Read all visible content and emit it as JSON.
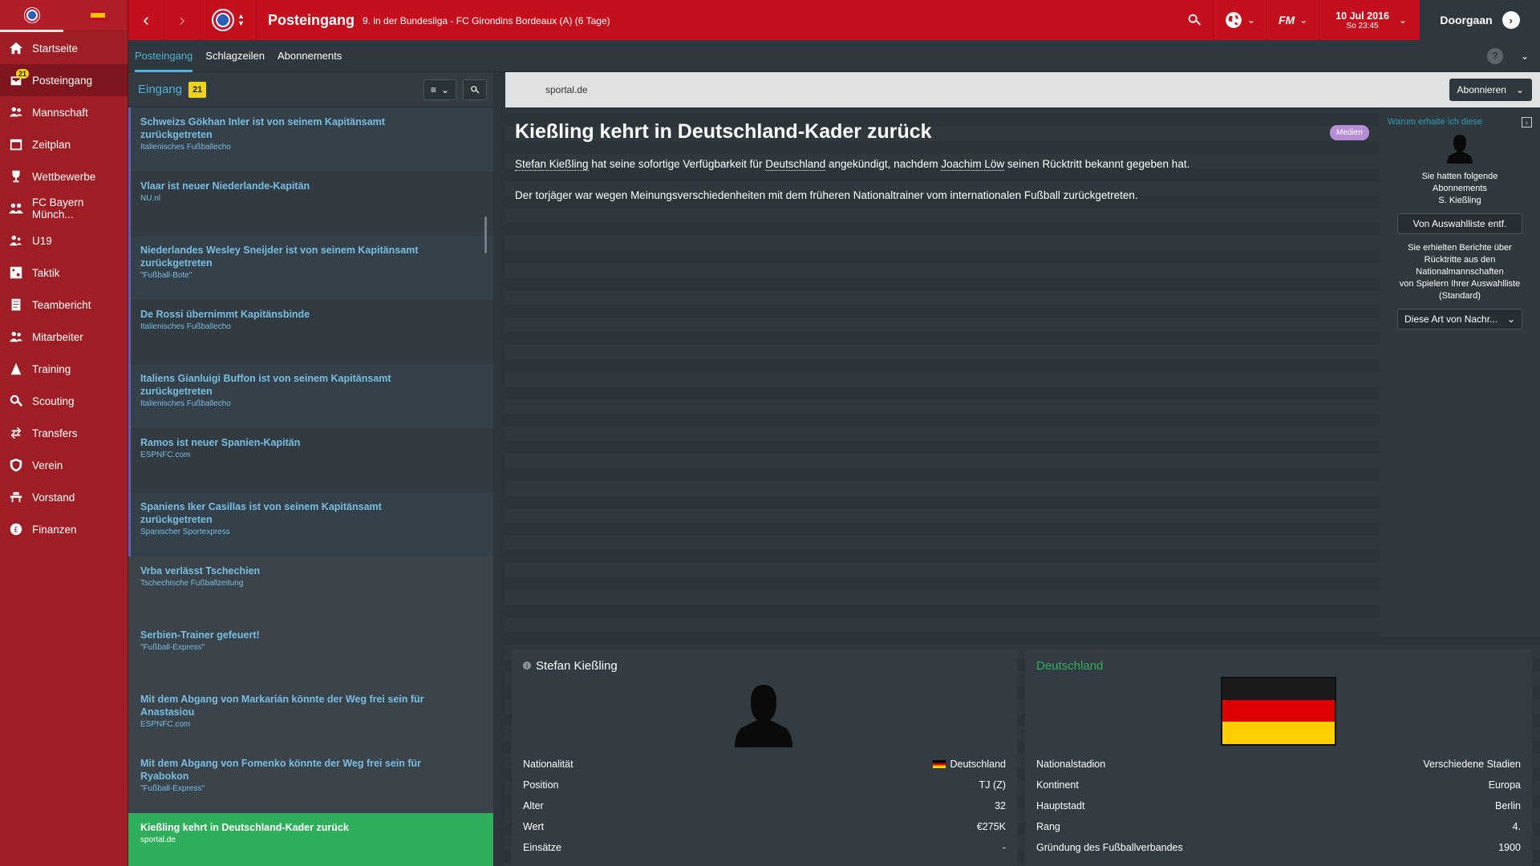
{
  "sidebar": {
    "items": [
      {
        "label": "Startseite",
        "icon": "home-icon"
      },
      {
        "label": "Posteingang",
        "icon": "inbox-icon",
        "badge": "21"
      },
      {
        "label": "Mannschaft",
        "icon": "squad-icon"
      },
      {
        "label": "Zeitplan",
        "icon": "calendar-icon"
      },
      {
        "label": "Wettbewerbe",
        "icon": "trophy-icon"
      },
      {
        "label": "FC Bayern Münch...",
        "icon": "team-icon"
      },
      {
        "label": "U19",
        "icon": "youth-icon"
      },
      {
        "label": "Taktik",
        "icon": "tactics-icon"
      },
      {
        "label": "Teambericht",
        "icon": "report-icon"
      },
      {
        "label": "Mitarbeiter",
        "icon": "staff-icon"
      },
      {
        "label": "Training",
        "icon": "training-icon"
      },
      {
        "label": "Scouting",
        "icon": "search-icon"
      },
      {
        "label": "Transfers",
        "icon": "transfers-icon"
      },
      {
        "label": "Verein",
        "icon": "club-icon"
      },
      {
        "label": "Vorstand",
        "icon": "board-icon"
      },
      {
        "label": "Finanzen",
        "icon": "finance-icon"
      }
    ]
  },
  "topbar": {
    "title": "Posteingang",
    "subtitle": "9. in der Bundesliga - FC Girondins Bordeaux (A) (6 Tage)",
    "date": "10 Jul 2016",
    "time": "So 23:45",
    "continue_label": "Doorgaan",
    "fm_label": "FM"
  },
  "tabs": [
    "Posteingang",
    "Schlagzeilen",
    "Abonnements"
  ],
  "inbox": {
    "label": "Eingang",
    "count": "21",
    "messages": [
      {
        "title": "Schweizs Gökhan Inler ist von seinem Kapitänsamt zurückgetreten",
        "source": "Italienisches Fußballecho"
      },
      {
        "title": "Vlaar ist neuer Niederlande-Kapitän",
        "source": "NU.nl"
      },
      {
        "title": "Niederlandes Wesley Sneijder ist von seinem Kapitänsamt zurückgetreten",
        "source": "\"Fußball-Bote\""
      },
      {
        "title": "De Rossi übernimmt Kapitänsbinde",
        "source": "Italienisches Fußballecho"
      },
      {
        "title": "Italiens Gianluigi Buffon ist von seinem Kapitänsamt zurückgetreten",
        "source": "Italienisches Fußballecho"
      },
      {
        "title": "Ramos ist neuer Spanien-Kapitän",
        "source": "ESPNFC.com"
      },
      {
        "title": "Spaniens Iker Casillas ist von seinem Kapitänsamt zurückgetreten",
        "source": "Spanischer Sportexpress"
      },
      {
        "title": "Vrba verlässt Tschechien",
        "source": "Tschechische Fußballzeitung"
      },
      {
        "title": "Serbien-Trainer gefeuert!",
        "source": "\"Fußball-Express\""
      },
      {
        "title": "Mit dem Abgang von Markarián könnte der Weg frei sein für Anastasiou",
        "source": "ESPNFC.com"
      },
      {
        "title": "Mit dem Abgang von Fomenko könnte der Weg frei sein für Ryabokon",
        "source": "\"Fußball-Express\""
      },
      {
        "title": "Kießling kehrt in Deutschland-Kader zurück",
        "source": "sportal.de"
      }
    ]
  },
  "article": {
    "source": "sportal.de",
    "subscribe_label": "Abonnieren",
    "title": "Kießling kehrt in Deutschland-Kader zurück",
    "tag": "Medien",
    "p1_a": "Stefan Kießling",
    "p1_b": " hat seine sofortige Verfügbarkeit für ",
    "p1_c": "Deutschland",
    "p1_d": " angekündigt, nachdem ",
    "p1_e": "Joachim Löw",
    "p1_f": " seinen Rücktritt bekannt gegeben hat.",
    "p2": "Der torjäger war wegen Meinungsverschiedenheiten mit dem früheren Nationaltrainer vom internationalen Fußball zurückgetreten."
  },
  "why_panel": {
    "title": "Warum erhalte ich diese",
    "text1_line1": "Sie hatten folgende",
    "text1_line2": "Abonnements",
    "text1_line3": "S. Kießling",
    "remove_button": "Von Auswahlliste entf.",
    "text2_line1": "Sie erhielten Berichte über",
    "text2_line2": "Rücktritte aus den",
    "text2_line3": "Nationalmannschaften",
    "text2_line4": "von Spielern Ihrer Auswahlliste",
    "text2_line5": "(Standard)",
    "select_label": "Diese Art von Nachr..."
  },
  "player_card": {
    "name": "Stefan Kießling",
    "rows": [
      {
        "label": "Nationalität",
        "value": "Deutschland"
      },
      {
        "label": "Position",
        "value": "TJ (Z)"
      },
      {
        "label": "Alter",
        "value": "32"
      },
      {
        "label": "Wert",
        "value": "€275K"
      },
      {
        "label": "Einsätze",
        "value": "-"
      }
    ]
  },
  "nation_card": {
    "name": "Deutschland",
    "rows": [
      {
        "label": "Nationalstadion",
        "value": "Verschiedene Stadien"
      },
      {
        "label": "Kontinent",
        "value": "Europa"
      },
      {
        "label": "Hauptstadt",
        "value": "Berlin"
      },
      {
        "label": "Rang",
        "value": "4."
      },
      {
        "label": "Gründung des Fußballverbandes",
        "value": "1900"
      }
    ]
  },
  "colors": {
    "sidebar": "#9f1d25",
    "topbar": "#c4101d",
    "accent": "#4fb3d9",
    "selected": "#2fae5b",
    "badge": "#f0d21b"
  }
}
